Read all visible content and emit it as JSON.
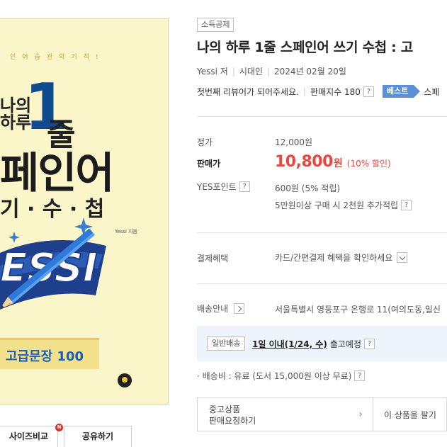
{
  "cover": {
    "slogan": "인어습관의기적!",
    "title_naui": "나의",
    "title_haru": "하루",
    "title_one": "1",
    "title_jul": "줄",
    "title_spanish": "페인어",
    "title_sub": "기 · 수 · 첩",
    "author_small": "Yessi 지음",
    "yessi_text": "ESSI",
    "banner": "고급문장 100"
  },
  "buttons": {
    "size_compare": "사이즈비교",
    "share": "공유하기",
    "new_badge": "N"
  },
  "product": {
    "tag": "소득공제",
    "title": "나의 하루 1줄 스페인어 쓰기 수첩 : 고",
    "author": "Yessi 저",
    "publisher": "시대인",
    "date": "2024년 02월 20일",
    "review_prompt": "첫번째 리뷰어가 되어주세요.",
    "sales_index_label": "판매지수 180",
    "best_label": "베스트",
    "best_rest": "스페"
  },
  "price": {
    "list_label": "정가",
    "list_value": "12,000원",
    "sale_label": "판매가",
    "sale_value": "10,800",
    "sale_unit": "원",
    "discount": "(10% 할인)",
    "points_label": "YES포인트",
    "points_value": "600원 (5% 적립)",
    "points_extra": "5만원이상 구매 시 2천원 추가적립"
  },
  "benefit": {
    "label": "결제혜택",
    "value": "카드/간편결제 혜택을 확인하세요"
  },
  "delivery": {
    "label": "배송안내",
    "address": "서울특별시 영등포구 은행로 11(여의도동,일신",
    "type_tag": "일반배송",
    "eta_bold": "1일 이내(1/24, 수)",
    "eta_rest": "출고예정",
    "fee": "· 배송비 : 유료 (도서 15,000원 이상 무료)"
  },
  "used": {
    "line1": "중고상품",
    "line2": "판매요청하기",
    "chevron": "›",
    "sell": "이 상품을 팔기"
  },
  "help_glyph": "?",
  "colors": {
    "sale_red": "#e8483f",
    "best_blue": "#5b8fd6",
    "cover_yellow": "#fbf6c9",
    "cover_blue": "#1a5fb5",
    "ship_bg": "#eef4fb"
  }
}
